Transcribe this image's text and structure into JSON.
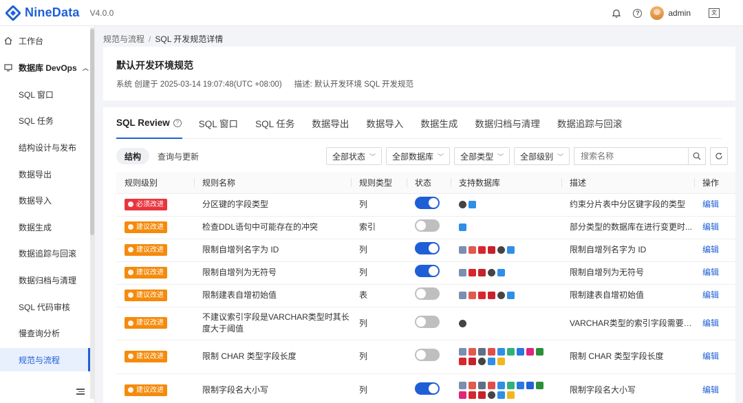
{
  "header": {
    "brand": "NineData",
    "version": "V4.0.0",
    "user": "admin",
    "lang_glyph": "文"
  },
  "sidebar": {
    "items": [
      {
        "label": "工作台",
        "kind": "top"
      },
      {
        "label": "数据库 DevOps",
        "kind": "group"
      },
      {
        "label": "SQL 窗口",
        "kind": "sub"
      },
      {
        "label": "SQL 任务",
        "kind": "sub"
      },
      {
        "label": "结构设计与发布",
        "kind": "sub"
      },
      {
        "label": "数据导出",
        "kind": "sub"
      },
      {
        "label": "数据导入",
        "kind": "sub"
      },
      {
        "label": "数据生成",
        "kind": "sub"
      },
      {
        "label": "数据追踪与回滚",
        "kind": "sub"
      },
      {
        "label": "数据归档与清理",
        "kind": "sub"
      },
      {
        "label": "SQL 代码审核",
        "kind": "sub"
      },
      {
        "label": "慢查询分析",
        "kind": "sub"
      },
      {
        "label": "规范与流程",
        "kind": "sub",
        "active": true
      }
    ]
  },
  "breadcrumb": {
    "parent": "规范与流程",
    "sep": "/",
    "current": "SQL 开发规范详情"
  },
  "spec": {
    "title": "默认开发环境规范",
    "meta": "系统 创建于 2025-03-14 19:07:48(UTC +08:00)",
    "desc": "描述:  默认开发环境 SQL 开发规范"
  },
  "tabs": [
    "SQL Review",
    "SQL 窗口",
    "SQL 任务",
    "数据导出",
    "数据导入",
    "数据生成",
    "数据归档与清理",
    "数据追踪与回滚"
  ],
  "segments": [
    "结构",
    "查询与更新"
  ],
  "filters": [
    "全部状态",
    "全部数据库",
    "全部类型",
    "全部级别"
  ],
  "search": {
    "placeholder": "搜索名称"
  },
  "table": {
    "headers": [
      "规则级别",
      "规则名称",
      "规则类型",
      "状态",
      "支持数据库",
      "描述",
      "操作"
    ],
    "edit_label": "编辑",
    "rows": [
      {
        "level": "必须改进",
        "name": "分区键的字段类型",
        "type": "列",
        "on": true,
        "dbs": [
          "c5",
          "c9"
        ],
        "desc": "约束分片表中分区键字段的类型"
      },
      {
        "level": "建议改进",
        "name": "检查DDL语句中可能存在的冲突",
        "type": "索引",
        "on": false,
        "dbs": [
          "c9"
        ],
        "desc": "部分类型的数据库在进行变更时..."
      },
      {
        "level": "建议改进",
        "name": "限制自增列名字为 ID",
        "type": "列",
        "on": true,
        "dbs": [
          "c1",
          "c2",
          "c3",
          "c4",
          "c5",
          "c9"
        ],
        "desc": "限制自增列名字为 ID"
      },
      {
        "level": "建议改进",
        "name": "限制自增列为无符号",
        "type": "列",
        "on": true,
        "dbs": [
          "c1",
          "c3",
          "c4",
          "c5",
          "c9"
        ],
        "desc": "限制自增列为无符号"
      },
      {
        "level": "建议改进",
        "name": "限制建表自增初始值",
        "type": "表",
        "on": false,
        "dbs": [
          "c1",
          "c2",
          "c3",
          "c4",
          "c5",
          "c9"
        ],
        "desc": "限制建表自增初始值"
      },
      {
        "level": "建议改进",
        "name": "不建议索引字段是VARCHAR类型时其长度大于阈值",
        "type": "列",
        "on": false,
        "dbs": [
          "c5"
        ],
        "desc": "VARCHAR类型的索引字段需要限..."
      },
      {
        "level": "建议改进",
        "name": "限制 CHAR 类型字段长度",
        "type": "列",
        "on": false,
        "dbs": [
          "c1",
          "c2",
          "c6",
          "c7",
          "c9",
          "c10",
          "c11",
          "c12",
          "c13",
          "c3",
          "c4",
          "c5",
          "c9",
          "c14"
        ],
        "desc": "限制 CHAR 类型字段长度"
      },
      {
        "level": "建议改进",
        "name": "限制字段名大小写",
        "type": "列",
        "on": true,
        "dbs": [
          "c1",
          "c2",
          "c6",
          "c7",
          "c9",
          "c10",
          "c11",
          "c15",
          "c13",
          "c12",
          "c3",
          "c4",
          "c5",
          "c9",
          "c14"
        ],
        "desc": "限制字段名大小写"
      }
    ]
  },
  "colors": {
    "accent": "#1f5fd6",
    "must": "#e8363e",
    "sugg": "#f58a0b",
    "c1": "#7b8fb0",
    "c2": "#e15a4f",
    "c3": "#d8262d",
    "c4": "#c6222b",
    "c5": "#444444",
    "c6": "#5d7186",
    "c7": "#e04e4a",
    "c9": "#2f8fe6",
    "c10": "#2fb27a",
    "c11": "#2a77e0",
    "c12": "#e0257a",
    "c13": "#2d8f3b",
    "c14": "#f2b71d",
    "c15": "#1e63d8"
  }
}
